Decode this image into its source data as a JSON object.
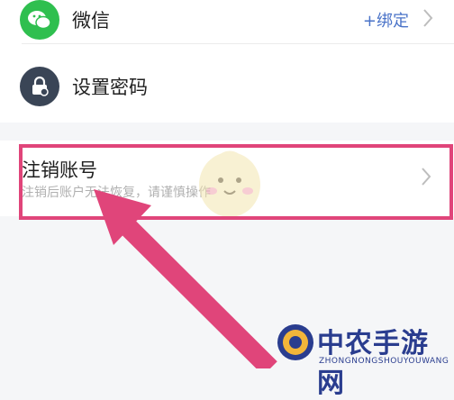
{
  "wechat_row": {
    "label": "微信",
    "bind_link": "+绑定",
    "icon": "wechat-icon"
  },
  "password_row": {
    "label": "设置密码",
    "icon": "lock-icon"
  },
  "cancel_account": {
    "title": "注销账号",
    "subtitle": "注销后账户无法恢复，请谨慎操作"
  },
  "colors": {
    "accent_link": "#4a73c8",
    "highlight": "#e0457a",
    "wechat_green": "#2fbf4f"
  },
  "watermark": {
    "title": "中农手游网",
    "sub": "ZHONGNONGSHOUYOUWANG"
  }
}
